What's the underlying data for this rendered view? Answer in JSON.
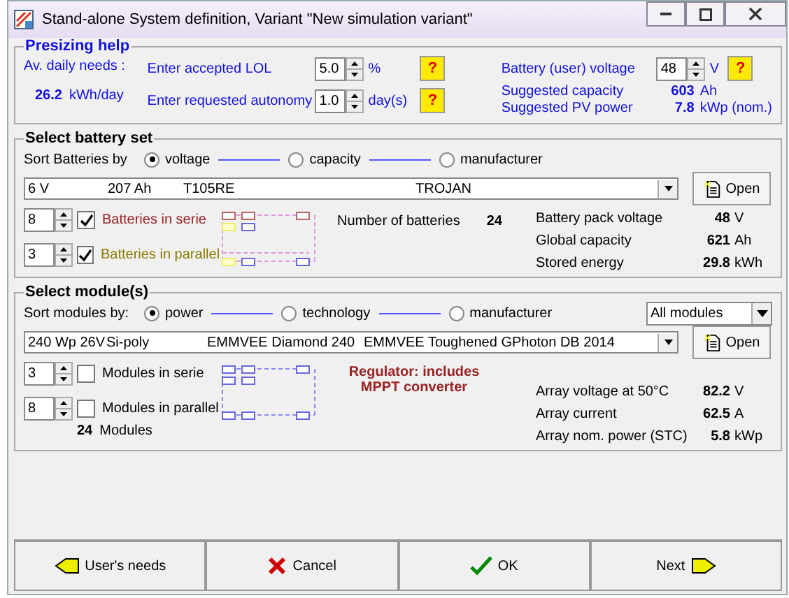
{
  "window": {
    "title": "Stand-alone System definition, Variant  \"New simulation variant\""
  },
  "presizing": {
    "title": "Presizing help",
    "daily_label": "Av. daily needs :",
    "daily_value": "26.2",
    "daily_unit": "kWh/day",
    "inputs": [
      {
        "label": "Enter accepted LOL",
        "value": "5.0",
        "unit": "%",
        "help": "?"
      },
      {
        "label": "Enter requested autonomy",
        "value": "1.0",
        "unit": "day(s)",
        "help": "?"
      }
    ],
    "voltage": {
      "label": "Battery (user) voltage",
      "value": "48",
      "unit": "V",
      "help": "?"
    },
    "suggested": [
      {
        "label": "Suggested capacity",
        "value": "603",
        "unit": "Ah"
      },
      {
        "label": "Suggested PV power",
        "value": "7.8",
        "unit": "kWp (nom.)"
      }
    ]
  },
  "battery": {
    "title": "Select battery set",
    "sort_label": "Sort Batteries by",
    "sort_options": [
      {
        "label": "voltage",
        "selected": true
      },
      {
        "label": "capacity",
        "selected": false
      },
      {
        "label": "manufacturer",
        "selected": false
      }
    ],
    "selection": [
      "6 V",
      "207 Ah",
      "T105RE",
      "TROJAN"
    ],
    "open_button": "Open",
    "counts": [
      {
        "value": "8",
        "label": "Batteries in serie",
        "checked": true
      },
      {
        "value": "3",
        "label": "Batteries in parallel",
        "checked": true
      }
    ],
    "number_label": "Number of batteries",
    "number_value": "24",
    "stats": [
      {
        "label": "Battery pack voltage",
        "value": "48",
        "unit": "V"
      },
      {
        "label": "Global capacity",
        "value": "621",
        "unit": "Ah"
      },
      {
        "label": "Stored energy",
        "value": "29.8",
        "unit": "kWh"
      }
    ]
  },
  "modules": {
    "title": "Select module(s)",
    "sort_label": "Sort modules by:",
    "sort_options": [
      {
        "label": "power",
        "selected": true
      },
      {
        "label": "technology",
        "selected": false
      },
      {
        "label": "manufacturer",
        "selected": false
      }
    ],
    "filter": "All modules",
    "selection": [
      "240 Wp 26V",
      "Si-poly",
      "EMMVEE Diamond 240",
      "EMMVEE Toughened GPhoton DB 2014"
    ],
    "open_button": "Open",
    "counts": [
      {
        "value": "3",
        "label": "Modules in serie",
        "checked": false
      },
      {
        "value": "8",
        "label": "Modules in parallel",
        "checked": false
      }
    ],
    "total_value": "24",
    "total_label": "Modules",
    "note": [
      "Regulator: includes",
      "MPPT converter"
    ],
    "stats": [
      {
        "label": "Array voltage at 50°C",
        "value": "82.2",
        "unit": "V"
      },
      {
        "label": "Array current",
        "value": "62.5",
        "unit": "A"
      },
      {
        "label": "Array nom. power (STC)",
        "value": "5.8",
        "unit": "kWp"
      }
    ]
  },
  "buttons": [
    {
      "label": "User's needs",
      "kind": "back"
    },
    {
      "label": "Cancel",
      "kind": "cancel"
    },
    {
      "label": "OK",
      "kind": "ok"
    },
    {
      "label": "Next",
      "kind": "next"
    }
  ]
}
